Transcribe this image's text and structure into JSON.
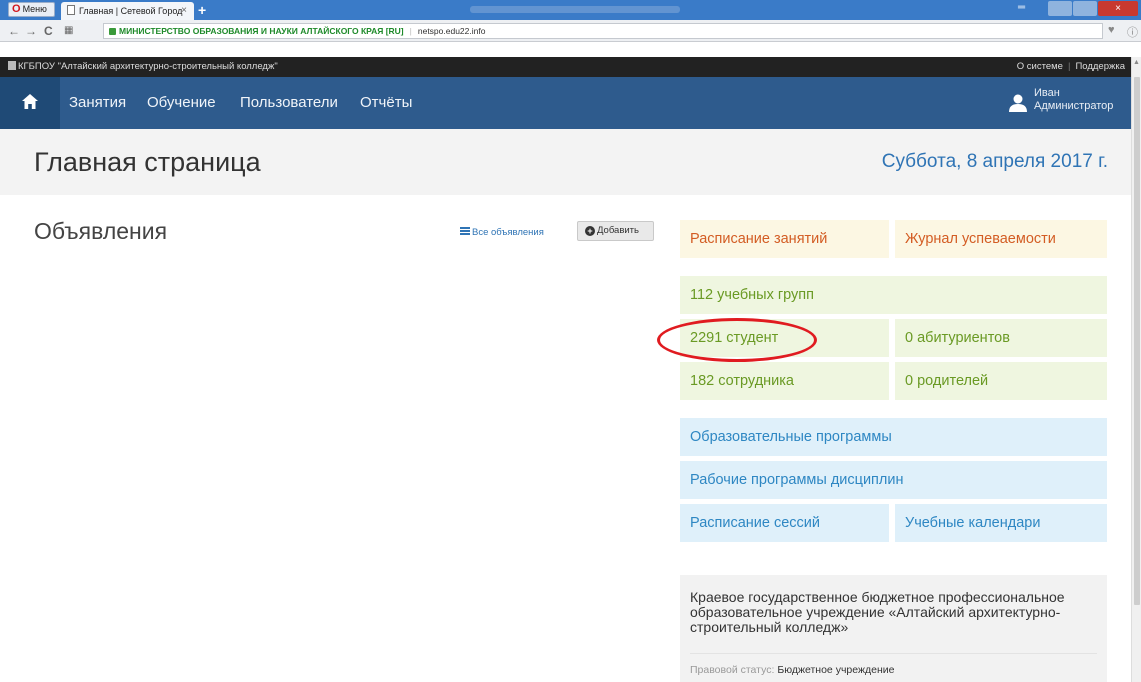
{
  "browser": {
    "menu_label": "Меню",
    "tab_title": "Главная | Сетевой Город",
    "tab_close": "×",
    "new_tab": "+",
    "cert_owner": "МИНИСТЕРСТВО ОБРАЗОВАНИЯ И НАУКИ АЛТАЙСКОГО КРАЯ [RU]",
    "separator": "|",
    "domain": "netspo.edu22.info",
    "close_glyph": "×"
  },
  "topbar": {
    "org_name": "КГБПОУ \"Алтайский архитектурно-строительный колледж\"",
    "about": "О системе",
    "separator": "|",
    "support": "Поддержка"
  },
  "nav": {
    "items": [
      "Занятия",
      "Обучение",
      "Пользователи",
      "Отчёты"
    ],
    "user_name": "Иван",
    "user_role": "Администратор"
  },
  "header": {
    "title": "Главная страница",
    "date": "Суббота, 8 апреля 2017 г."
  },
  "announcements": {
    "title": "Объявления",
    "all_link": "Все объявления",
    "add_button": "Добавить"
  },
  "tiles": {
    "schedule": "Расписание занятий",
    "grades": "Журнал успеваемости",
    "groups": "112 учебных групп",
    "students": "2291 студент",
    "applicants": "0 абитуриентов",
    "staff": "182 сотрудника",
    "parents": "0 родителей",
    "edu_programs": "Образовательные программы",
    "work_programs": "Рабочие программы дисциплин",
    "session_schedule": "Расписание сессий",
    "calendars": "Учебные календари"
  },
  "org_info": {
    "full_name": "Краевое государственное бюджетное профессиональное образовательное учреждение «Алтайский архитектурно-строительный колледж»",
    "legal_label": "Правовой статус:",
    "legal_value": "Бюджетное учреждение"
  },
  "colors": {
    "nav_bg": "#2e5b8d",
    "accent_blue": "#2f74b5",
    "tile_orange_text": "#d35d24",
    "tile_green_text": "#6a9a24",
    "tile_blue_text": "#2e87c3",
    "highlight_circle": "#e01b20"
  }
}
